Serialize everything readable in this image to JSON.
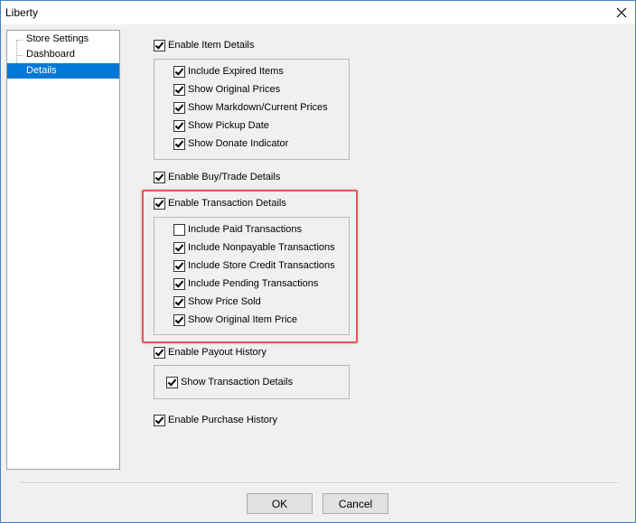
{
  "window": {
    "title": "Liberty",
    "close_icon": "close-icon"
  },
  "tree": {
    "items": [
      {
        "label": "Store Settings",
        "selected": false
      },
      {
        "label": "Dashboard",
        "selected": false
      },
      {
        "label": "Details",
        "selected": true
      }
    ]
  },
  "item_details": {
    "enable": {
      "label": "Enable Item Details",
      "checked": true
    },
    "options": [
      {
        "label": "Include Expired Items",
        "checked": true
      },
      {
        "label": "Show Original Prices",
        "checked": true
      },
      {
        "label": "Show Markdown/Current Prices",
        "checked": true
      },
      {
        "label": "Show Pickup Date",
        "checked": true
      },
      {
        "label": "Show Donate Indicator",
        "checked": true
      }
    ]
  },
  "buy_trade": {
    "enable": {
      "label": "Enable Buy/Trade Details",
      "checked": true
    }
  },
  "transaction_details": {
    "enable": {
      "label": "Enable Transaction Details",
      "checked": true
    },
    "options": [
      {
        "label": "Include Paid Transactions",
        "checked": false
      },
      {
        "label": "Include Nonpayable Transactions",
        "checked": true
      },
      {
        "label": "Include Store Credit Transactions",
        "checked": true
      },
      {
        "label": "Include Pending Transactions",
        "checked": true
      },
      {
        "label": "Show Price Sold",
        "checked": true
      },
      {
        "label": "Show Original Item Price",
        "checked": true
      }
    ]
  },
  "payout_history": {
    "enable": {
      "label": "Enable Payout History",
      "checked": true
    },
    "options": [
      {
        "label": "Show Transaction Details",
        "checked": true
      }
    ]
  },
  "purchase_history": {
    "enable": {
      "label": "Enable Purchase History",
      "checked": true
    }
  },
  "buttons": {
    "ok": "OK",
    "cancel": "Cancel"
  },
  "colors": {
    "highlight": "#e05a5a",
    "selection": "#0078d7"
  }
}
